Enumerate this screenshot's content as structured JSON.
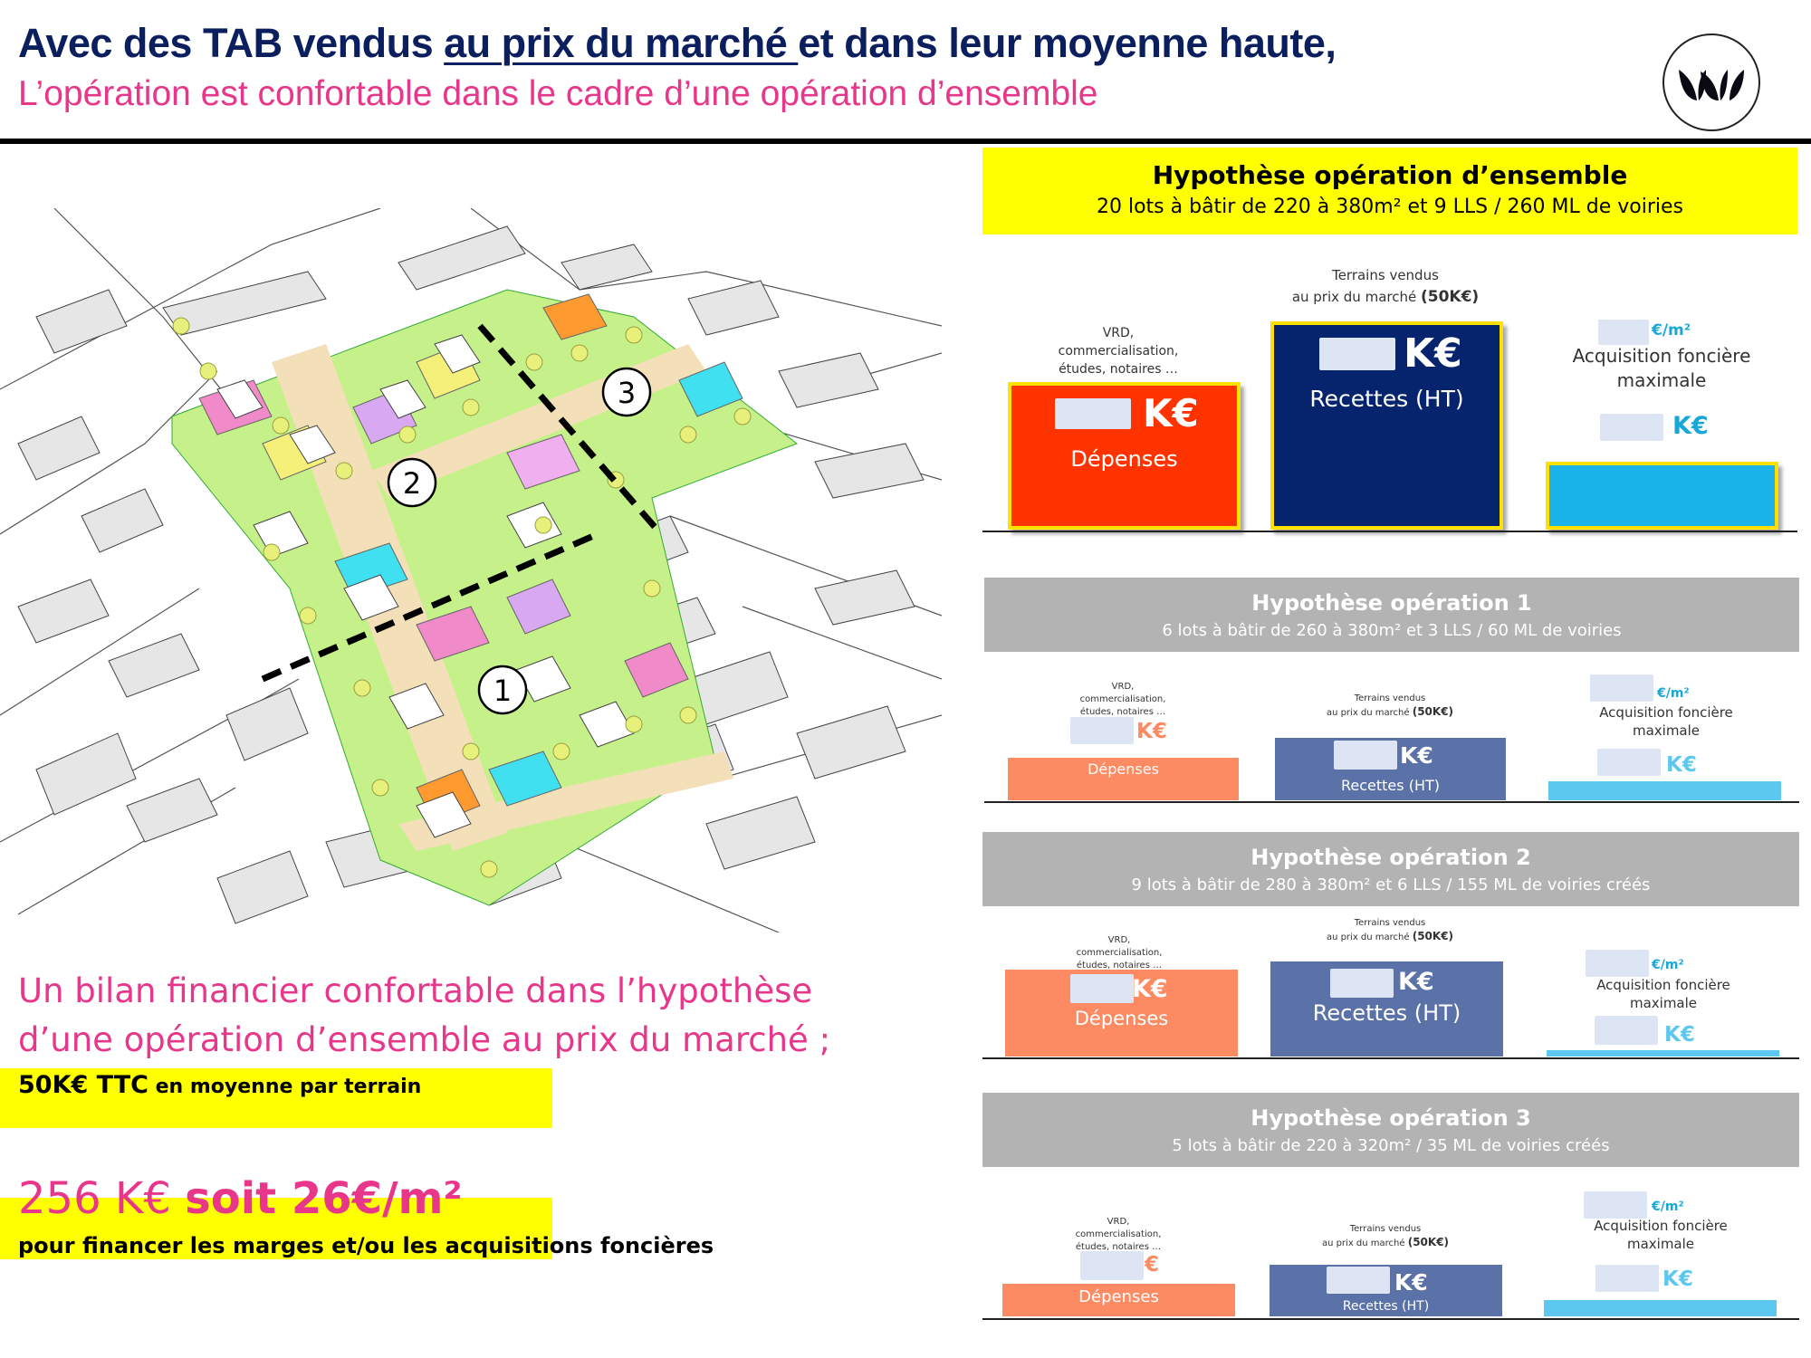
{
  "header": {
    "title_part1": "Avec des TAB vendus ",
    "title_underlined": "au prix du marché ",
    "title_part2": "et dans leur moyenne haute,",
    "subtitle": "L’opération est confortable dans le cadre d’une opération d’ensemble"
  },
  "colors": {
    "title_navy": "#0b1e5e",
    "pink": "#e8378b",
    "highlight_yellow": "#ffff00",
    "expenses_red": "#ff3300",
    "revenue_navy": "#06246e",
    "land_cyan": "#1ab3e8",
    "expenses_salmon": "#fc8a62",
    "revenue_slate": "#5b72a8",
    "land_light_cyan": "#5cc8f0",
    "scenario_grey": "#b3b3b3"
  },
  "map": {
    "zone_labels": [
      "1",
      "2",
      "3"
    ]
  },
  "scenario_main": {
    "title": "Hypothèse opération d’ensemble",
    "subtitle": "20 lots à bâtir de 220 à 380m² et 9 LLS / 260 ML de voiries",
    "expenses_note": "VRD, commercialisation, études, notaires …",
    "revenue_note_line1": "Terrains vendus",
    "revenue_note_line2": "au prix du marché ",
    "revenue_note_bold": "(50K€)",
    "expenses_unit": "K€",
    "expenses_label": "Dépenses",
    "revenue_unit": "K€",
    "revenue_label": "Recettes (HT)",
    "per_m2_unit": "€/m²",
    "land_label_line1": "Acquisition foncière",
    "land_label_line2": "maximale",
    "land_unit": "K€"
  },
  "scenarios": [
    {
      "title": "Hypothèse opération 1",
      "subtitle": "6 lots à bâtir de 260 à 380m² et 3 LLS / 60 ML de voiries",
      "expenses_note": "VRD, commercialisation, études, notaires …",
      "revenue_note_line1": "Terrains vendus",
      "revenue_note_line2": "au prix du marché ",
      "revenue_note_bold": "(50K€)",
      "expenses_unit": "K€",
      "expenses_label": "Dépenses",
      "revenue_unit": "K€",
      "revenue_label": "Recettes (HT)",
      "per_m2_unit": "€/m²",
      "land_label_line1": "Acquisition foncière",
      "land_label_line2": "maximale",
      "land_unit": "K€"
    },
    {
      "title": "Hypothèse opération 2",
      "subtitle": "9 lots à bâtir de 280 à 380m² et 6 LLS / 155 ML de voiries créés",
      "expenses_note": "VRD, commercialisation, études, notaires …",
      "revenue_note_line1": "Terrains vendus",
      "revenue_note_line2": "au prix du marché ",
      "revenue_note_bold": "(50K€)",
      "expenses_unit": "K€",
      "expenses_label": "Dépenses",
      "revenue_unit": "K€",
      "revenue_label": "Recettes (HT)",
      "per_m2_unit": "€/m²",
      "land_label_line1": "Acquisition foncière",
      "land_label_line2": "maximale",
      "land_unit": "K€"
    },
    {
      "title": "Hypothèse opération 3",
      "subtitle": "5 lots à bâtir de 220 à 320m² / 35 ML de voiries créés",
      "expenses_note": "VRD, commercialisation, études, notaires …",
      "revenue_note_line1": "Terrains vendus",
      "revenue_note_line2": "au prix du marché ",
      "revenue_note_bold": "(50K€)",
      "expenses_unit": "€",
      "expenses_label": "Dépenses",
      "revenue_unit": "K€",
      "revenue_label": "Recettes (HT)",
      "per_m2_unit": "€/m²",
      "land_label_line1": "Acquisition foncière",
      "land_label_line2": "maximale",
      "land_unit": "K€"
    }
  ],
  "summary": {
    "line1": "Un bilan financier confortable dans l’hypothèse",
    "line2": "d’une opération d’ensemble au prix du marché ;",
    "price_bold": "50K€ TTC",
    "price_rest": " en moyenne par terrain",
    "amount": "256 K€ ",
    "amount_bold": "soit 26€/m²",
    "financing": "pour financer les marges et/ou les acquisitions foncières"
  }
}
